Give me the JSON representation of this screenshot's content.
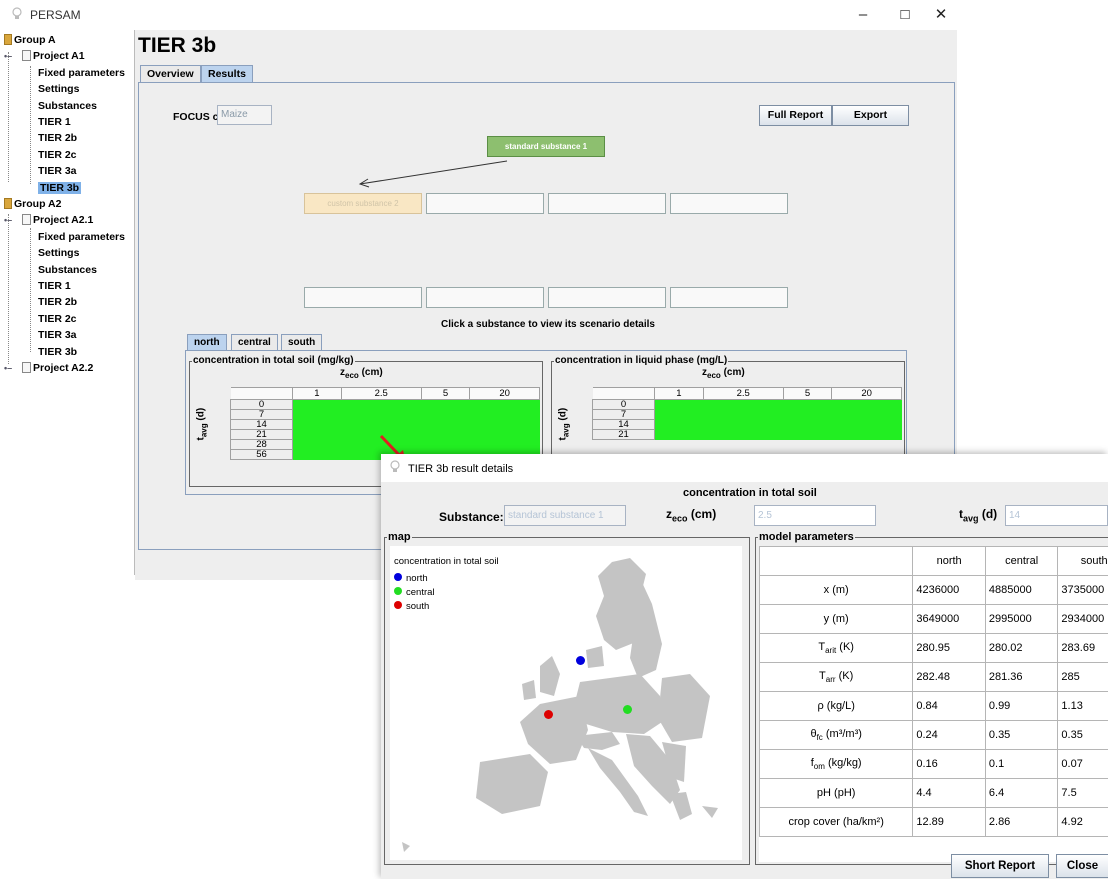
{
  "app": {
    "title": "PERSAM"
  },
  "window_controls": {
    "minimize": "–",
    "maximize": "□",
    "close": "✕"
  },
  "tree": {
    "items": [
      {
        "label": "Group A",
        "kind": "group"
      },
      {
        "label": "Project A1",
        "kind": "project"
      },
      {
        "label": "Fixed parameters",
        "kind": "leaf"
      },
      {
        "label": "Settings",
        "kind": "leaf"
      },
      {
        "label": "Substances",
        "kind": "leaf"
      },
      {
        "label": "TIER 1",
        "kind": "leaf"
      },
      {
        "label": "TIER 2b",
        "kind": "leaf"
      },
      {
        "label": "TIER 2c",
        "kind": "leaf"
      },
      {
        "label": "TIER 3a",
        "kind": "leaf"
      },
      {
        "label": "TIER 3b",
        "kind": "leaf",
        "selected": true
      },
      {
        "label": "Group A2",
        "kind": "group"
      },
      {
        "label": "Project A2.1",
        "kind": "project"
      },
      {
        "label": "Fixed parameters",
        "kind": "leaf"
      },
      {
        "label": "Settings",
        "kind": "leaf"
      },
      {
        "label": "Substances",
        "kind": "leaf"
      },
      {
        "label": "TIER 1",
        "kind": "leaf"
      },
      {
        "label": "TIER 2b",
        "kind": "leaf"
      },
      {
        "label": "TIER 2c",
        "kind": "leaf"
      },
      {
        "label": "TIER 3a",
        "kind": "leaf"
      },
      {
        "label": "TIER 3b",
        "kind": "leaf"
      },
      {
        "label": "Project A2.2",
        "kind": "project"
      }
    ]
  },
  "main": {
    "title": "TIER 3b",
    "tabs": [
      {
        "label": "Overview"
      },
      {
        "label": "Results",
        "active": true
      }
    ],
    "focus_crop_label": "FOCUS crop:",
    "focus_crop_value": "Maize",
    "full_report_label": "Full Report",
    "export_label": "Export",
    "standard_substance": "standard substance 1",
    "custom_substance": "custom substance 2",
    "hint": "Click a substance to view its scenario details",
    "scenario_tabs": [
      {
        "label": "north",
        "active": true
      },
      {
        "label": "central"
      },
      {
        "label": "south"
      }
    ],
    "panels": [
      {
        "title": "concentration in total soil (mg/kg)"
      },
      {
        "title": "concentration in liquid phase (mg/L)"
      }
    ],
    "grid": {
      "z_label": "z",
      "z_sub": "eco",
      "z_unit": " (cm)",
      "t_label": "t",
      "t_sub": "avg",
      "t_unit": " (d)",
      "columns": [
        "1",
        "2.5",
        "5",
        "20"
      ],
      "rows_left": [
        "0",
        "7",
        "14",
        "21",
        "28",
        "56"
      ],
      "rows_right": [
        "0",
        "7",
        "14",
        "21"
      ]
    }
  },
  "dialog": {
    "title": "TIER 3b result details",
    "heading": "concentration in total soil",
    "substance_label": "Substance:",
    "substance_value": "standard substance 1",
    "zeco_value": "2.5",
    "tavg_value": "14",
    "map_group": "map",
    "params_group": "model parameters",
    "map_legend": {
      "title": "concentration in total soil",
      "items": [
        {
          "label": "north",
          "color": "#0000dd"
        },
        {
          "label": "central",
          "color": "#22dd22"
        },
        {
          "label": "south",
          "color": "#dd0000"
        }
      ]
    },
    "params": {
      "headers": [
        "",
        "north",
        "central",
        "south"
      ],
      "rows": [
        {
          "name": "x",
          "sub": "",
          "sup": "",
          "unit": " (m)",
          "values": [
            "4236000",
            "4885000",
            "3735000"
          ]
        },
        {
          "name": "y",
          "sub": "",
          "sup": "",
          "unit": " (m)",
          "values": [
            "3649000",
            "2995000",
            "2934000"
          ]
        },
        {
          "name": "T",
          "sub": "arit",
          "sup": "",
          "unit": " (K)",
          "values": [
            "280.95",
            "280.02",
            "283.69"
          ]
        },
        {
          "name": "T",
          "sub": "arr",
          "sup": "",
          "unit": " (K)",
          "values": [
            "282.48",
            "281.36",
            "285"
          ]
        },
        {
          "name": "ρ",
          "sub": "",
          "sup": "",
          "unit": " (kg/L)",
          "values": [
            "0.84",
            "0.99",
            "1.13"
          ]
        },
        {
          "name": "θ",
          "sub": "fc",
          "sup": "",
          "unit": " (m³/m³)",
          "values": [
            "0.24",
            "0.35",
            "0.35"
          ]
        },
        {
          "name": "f",
          "sub": "om",
          "sup": "",
          "unit": " (kg/kg)",
          "values": [
            "0.16",
            "0.1",
            "0.07"
          ]
        },
        {
          "name": "pH",
          "sub": "",
          "sup": "",
          "unit": " (pH)",
          "values": [
            "4.4",
            "6.4",
            "7.5"
          ]
        },
        {
          "name": "crop cover",
          "sub": "",
          "sup": "",
          "unit": " (ha/km²)",
          "values": [
            "12.89",
            "2.86",
            "4.92"
          ]
        }
      ]
    },
    "short_report_label": "Short Report",
    "close_label": "Close"
  }
}
